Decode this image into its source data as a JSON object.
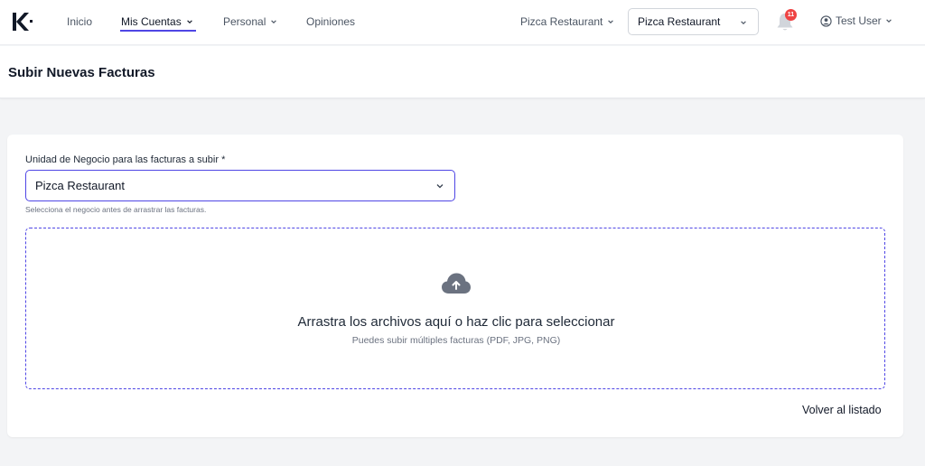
{
  "nav": {
    "items": [
      {
        "label": "Inicio"
      },
      {
        "label": "Mis Cuentas"
      },
      {
        "label": "Personal"
      },
      {
        "label": "Opiniones"
      }
    ],
    "restaurant_menu": "Pizca Restaurant",
    "business_select": "Pizca Restaurant",
    "notifications_count": "11",
    "user": "Test User"
  },
  "page": {
    "title": "Subir Nuevas Facturas"
  },
  "form": {
    "label": "Unidad de Negocio para las facturas a subir *",
    "selected": "Pizca Restaurant",
    "helper": "Selecciona el negocio antes de arrastrar las facturas."
  },
  "dropzone": {
    "title": "Arrastra los archivos aquí o haz clic para seleccionar",
    "subtitle": "Puedes subir múltiples facturas (PDF, JPG, PNG)"
  },
  "actions": {
    "back": "Volver al listado"
  },
  "colors": {
    "accent": "#4f46e5",
    "badge": "#ef4444"
  },
  "icons": [
    "logo-icon",
    "chevron-down-icon",
    "bell-icon",
    "user-circle-icon",
    "cloud-upload-icon"
  ]
}
